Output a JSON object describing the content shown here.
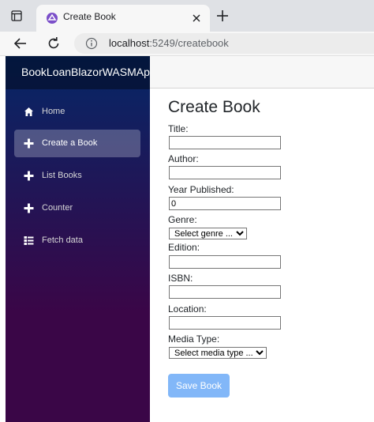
{
  "browser": {
    "tab_title": "Create Book",
    "url_host": "localhost",
    "url_rest": ":5249/createbook"
  },
  "app": {
    "brand": "BookLoanBlazorWASMApp",
    "nav": [
      {
        "label": "Home",
        "icon": "home-icon"
      },
      {
        "label": "Create a Book",
        "icon": "plus-icon",
        "active": true
      },
      {
        "label": "List Books",
        "icon": "plus-icon"
      },
      {
        "label": "Counter",
        "icon": "plus-icon"
      },
      {
        "label": "Fetch data",
        "icon": "list-rich-icon"
      }
    ]
  },
  "form": {
    "title": "Create Book",
    "fields": [
      {
        "label": "Title:",
        "value": ""
      },
      {
        "label": "Author:",
        "value": ""
      },
      {
        "label": "Year Published:",
        "value": "0"
      },
      {
        "label": "Genre:",
        "selected": "Select genre ..."
      },
      {
        "label": "Edition:",
        "value": ""
      },
      {
        "label": "ISBN:",
        "value": ""
      },
      {
        "label": "Location:",
        "value": ""
      },
      {
        "label": "Media Type:",
        "selected": "Select media type ..."
      }
    ],
    "save_label": "Save Book"
  },
  "colors": {
    "sidebar_top": "#052767",
    "sidebar_bottom": "#3a0647",
    "save_button": "#82b7f8"
  }
}
